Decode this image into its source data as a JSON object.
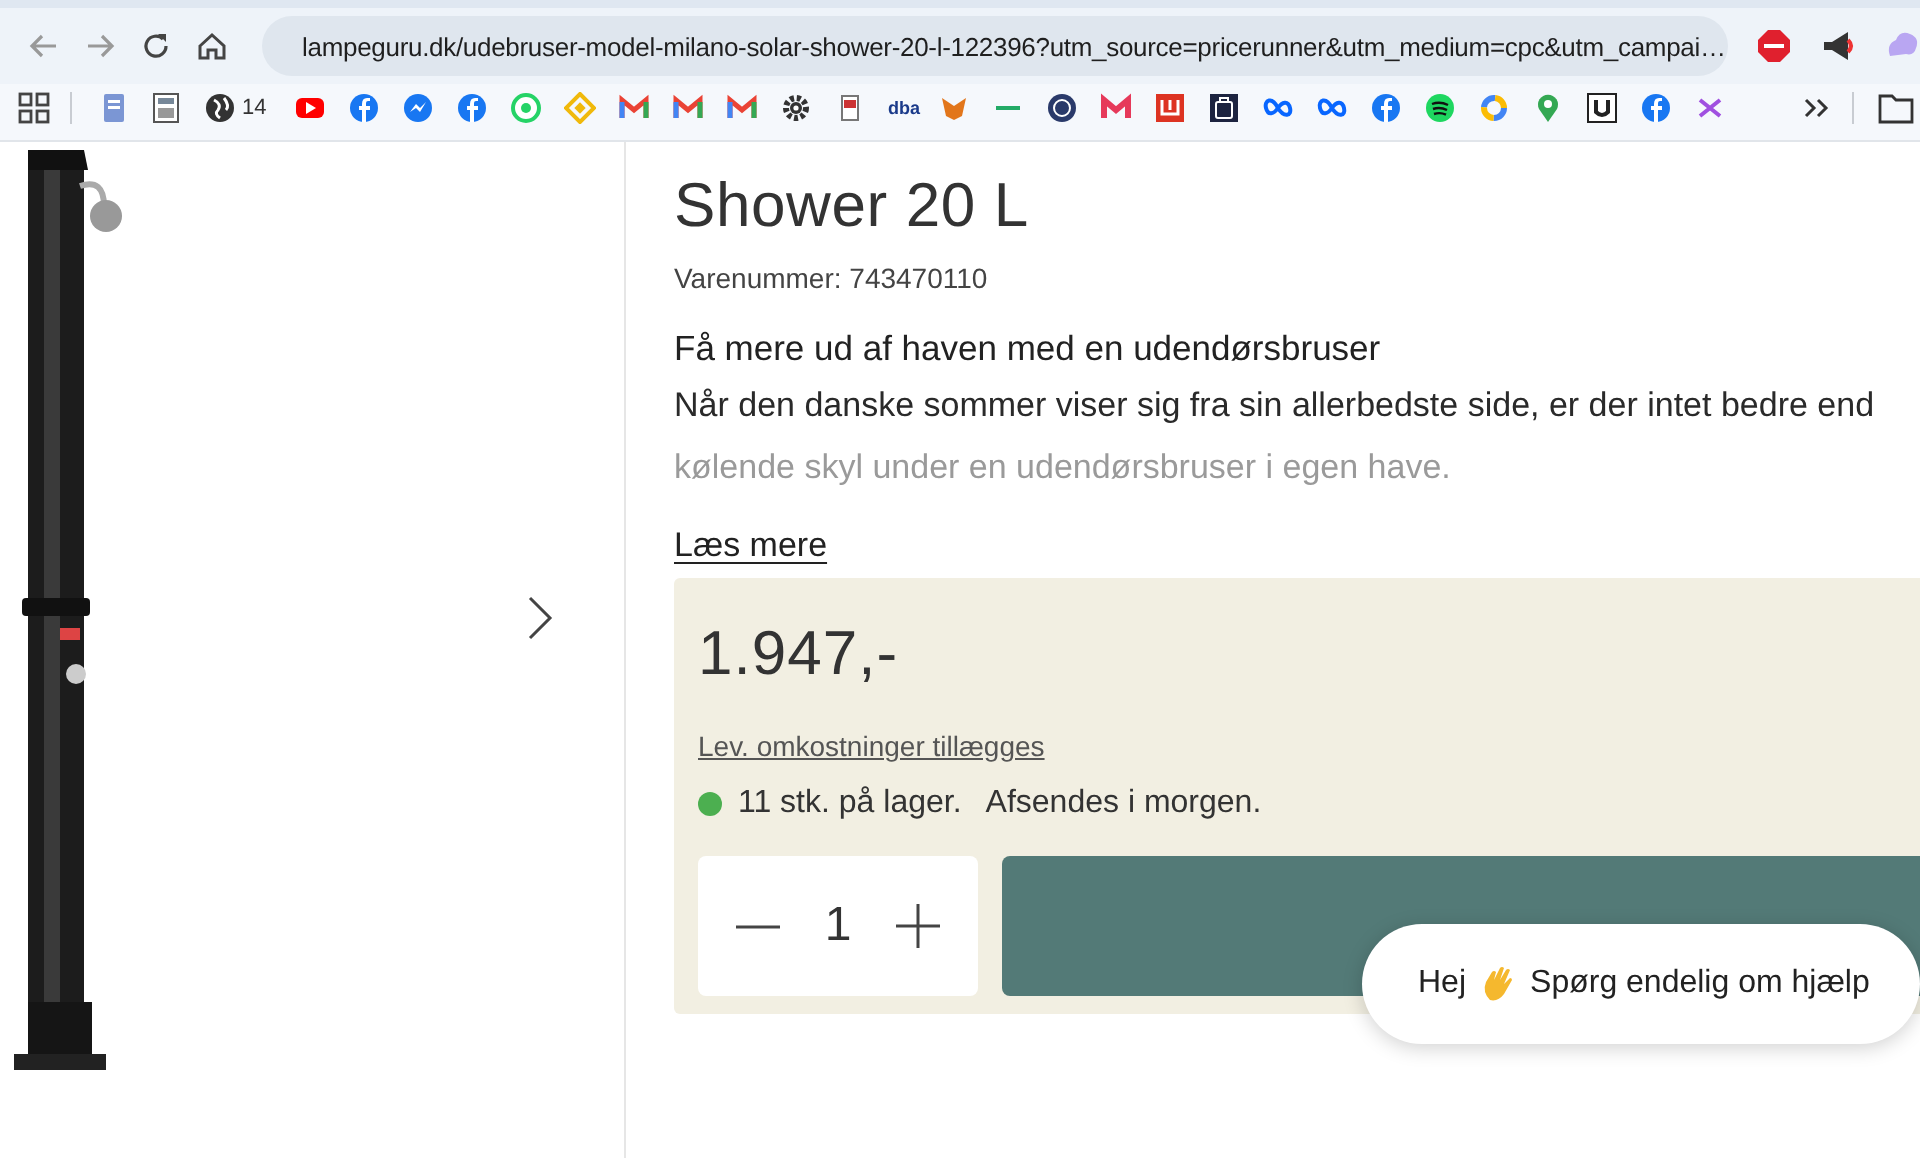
{
  "browser": {
    "url": "lampeguru.dk/udebruser-model-milano-solar-shower-20-l-122396?utm_source=pricerunner&utm_medium=cpc&utm_campai…"
  },
  "bookmarks": [
    {
      "label": "14"
    },
    {
      "label": "dba"
    }
  ],
  "product": {
    "title": "Shower 20 L",
    "sku": "Varenummer: 743470110",
    "heading": "Få mere ud af haven med en udendørsbruser",
    "description_lines": [
      "Når den danske sommer viser sig fra sin allerbedste side, er der intet bedre end",
      "kølende skyl under en udendørsbruser i egen have."
    ],
    "read_more": "Læs mere"
  },
  "purchase": {
    "price": "1.947,-",
    "shipping_note": "Lev. omkostninger tillægges",
    "stock": {
      "color": "#4caf50",
      "count": "11 stk. på lager.",
      "dispatch": "Afsendes i morgen."
    },
    "quantity": "1"
  },
  "chat": {
    "greeting": "Hej",
    "message": "Spørg endelig om hjælp"
  }
}
